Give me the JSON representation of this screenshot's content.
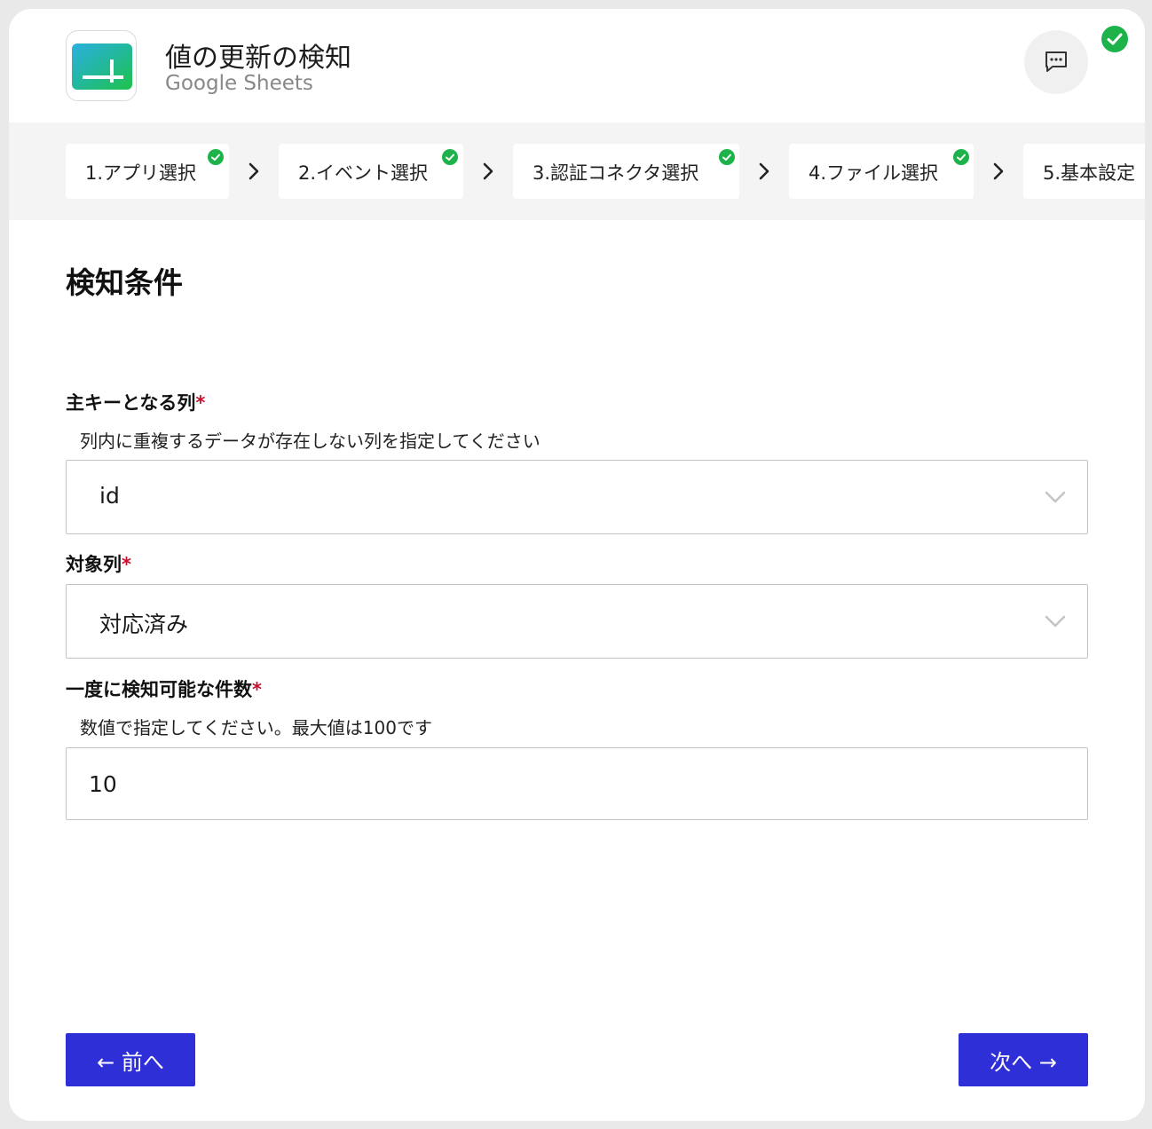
{
  "header": {
    "title": "値の更新の検知",
    "subtitle": "Google Sheets",
    "app_icon": "google-sheets-icon",
    "chat_icon": "chat-bubble-icon",
    "status_icon": "check-circle-icon"
  },
  "steps": [
    {
      "label": "1.アプリ選択",
      "completed": true
    },
    {
      "label": "2.イベント選択",
      "completed": true
    },
    {
      "label": "3.認証コネクタ選択",
      "completed": true
    },
    {
      "label": "4.ファイル選択",
      "completed": true
    },
    {
      "label": "5.基本設定",
      "completed": false
    }
  ],
  "section": {
    "title": "検知条件"
  },
  "fields": {
    "primary_key": {
      "label": "主キーとなる列",
      "required_mark": "*",
      "description": "列内に重複するデータが存在しない列を指定してください",
      "value": "id"
    },
    "target_column": {
      "label": "対象列",
      "required_mark": "*",
      "value": "対応済み"
    },
    "count": {
      "label": "一度に検知可能な件数",
      "required_mark": "*",
      "description": "数値で指定してください。最大値は100です",
      "value": "10"
    }
  },
  "buttons": {
    "prev": "← 前へ",
    "next": "次へ →"
  },
  "colors": {
    "accent": "#2f2fd8",
    "success": "#1db34a",
    "required": "#c8102e"
  }
}
